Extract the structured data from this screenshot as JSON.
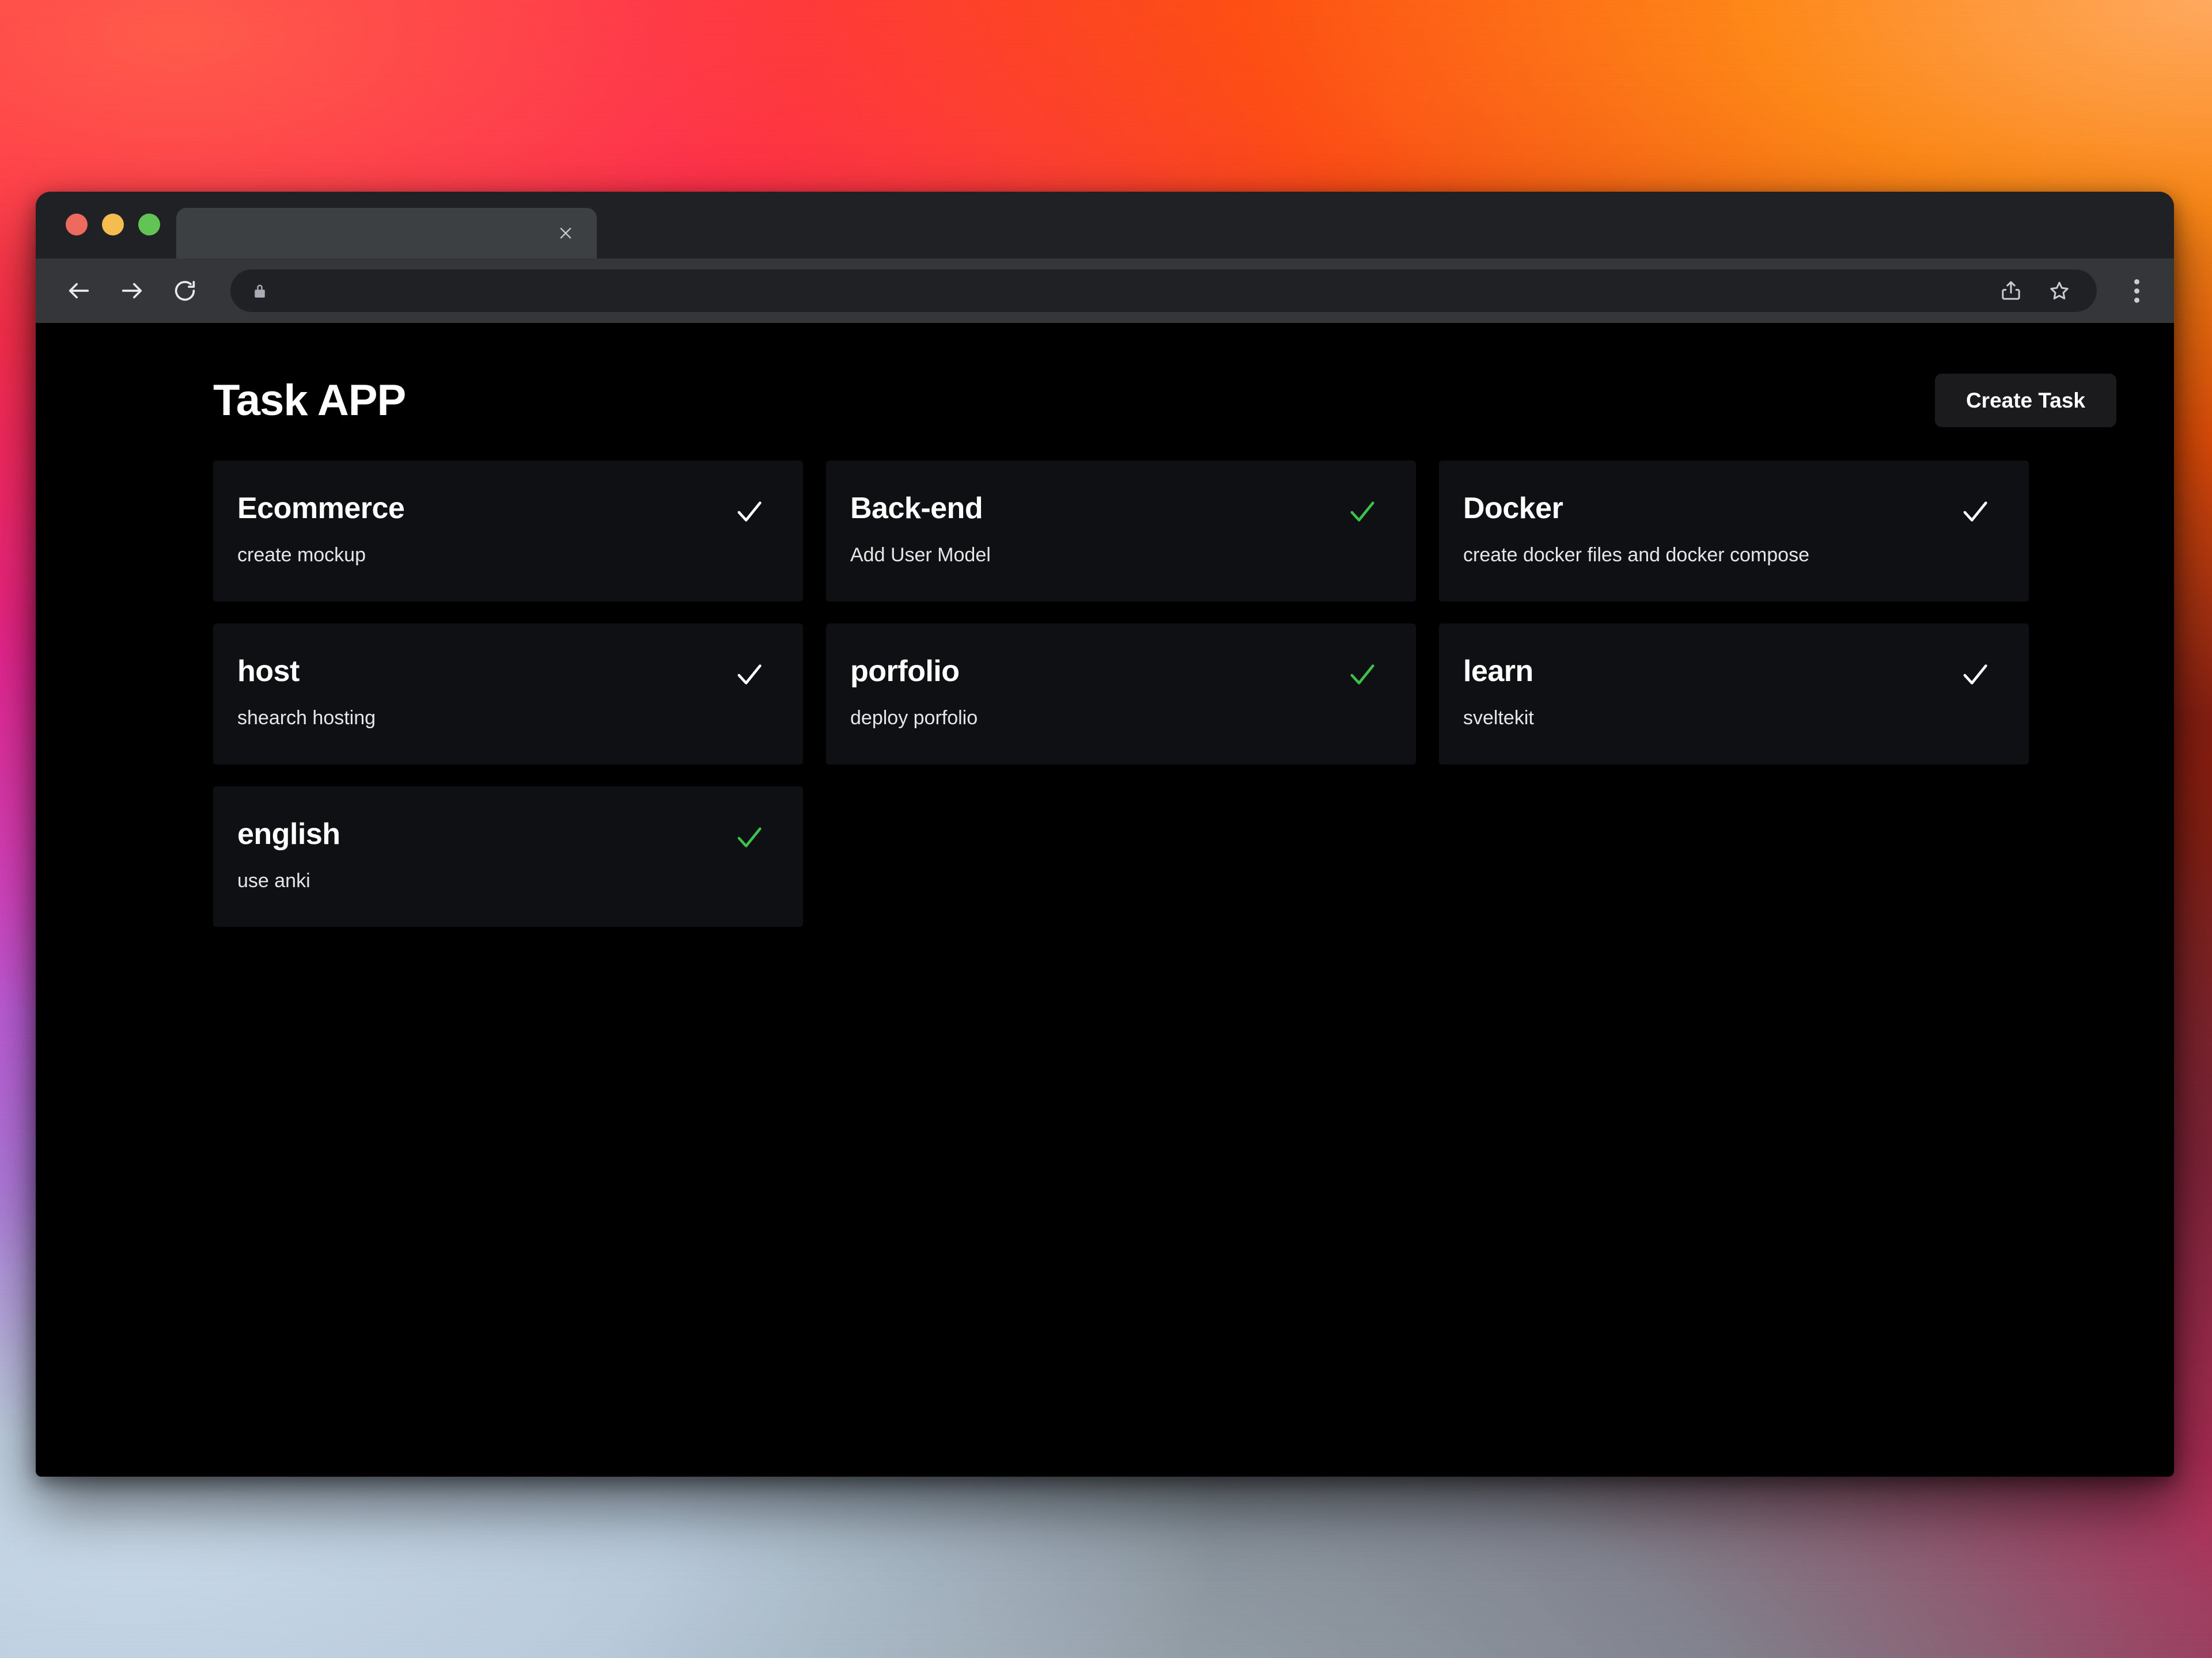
{
  "browser": {
    "tab": {
      "title": "",
      "close_icon": "close-icon"
    },
    "toolbar": {
      "back_icon": "back-arrow-icon",
      "forward_icon": "forward-arrow-icon",
      "reload_icon": "reload-icon",
      "lock_icon": "lock-icon",
      "url": "",
      "share_icon": "share-icon",
      "bookmark_icon": "star-icon",
      "menu_icon": "three-dots-menu-icon"
    },
    "traffic_lights": {
      "close": "#ee6a5f",
      "minimize": "#f5bd4f",
      "maximize": "#61c454"
    }
  },
  "app": {
    "title": "Task APP",
    "create_button_label": "Create Task",
    "colors": {
      "page_background": "#000000",
      "card_background": "#0f1013",
      "button_background": "#1b1b1d",
      "text_primary": "#ffffff",
      "text_secondary": "#e6e6e6",
      "check_done": "#3fc04a",
      "check_pending": "#ffffff"
    },
    "tasks": [
      {
        "name": "Ecommerce",
        "description": "create mockup",
        "check_color": "#ffffff",
        "completed": false
      },
      {
        "name": "Back-end",
        "description": "Add User Model",
        "check_color": "#3fc04a",
        "completed": true
      },
      {
        "name": "Docker",
        "description": "create docker files and docker compose",
        "check_color": "#ffffff",
        "completed": false
      },
      {
        "name": "host",
        "description": "shearch hosting",
        "check_color": "#ffffff",
        "completed": false
      },
      {
        "name": "porfolio",
        "description": "deploy porfolio",
        "check_color": "#3fc04a",
        "completed": true
      },
      {
        "name": "learn",
        "description": "sveltekit",
        "check_color": "#ffffff",
        "completed": false
      },
      {
        "name": "english",
        "description": "use anki",
        "check_color": "#3fc04a",
        "completed": true
      }
    ]
  }
}
